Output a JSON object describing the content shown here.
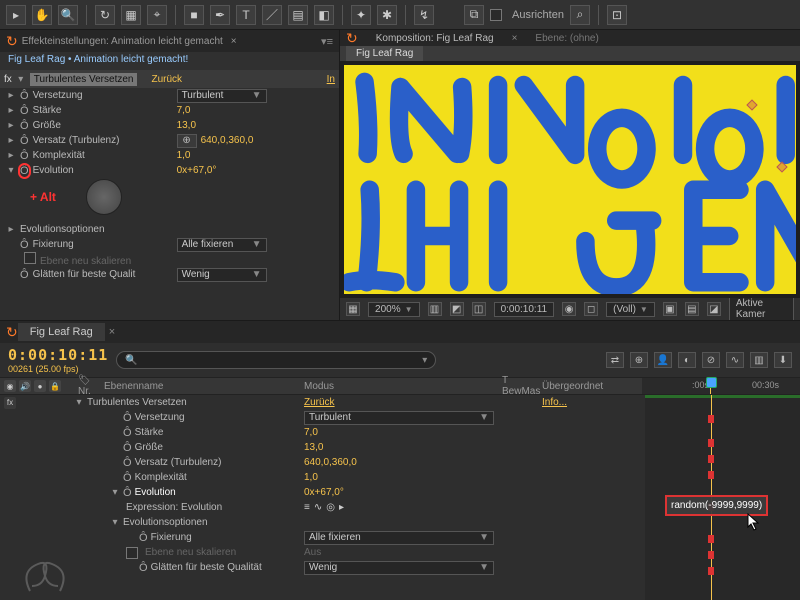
{
  "toolbar": {
    "align_label": "Ausrichten"
  },
  "effects_panel": {
    "tab": "Effekteinstellungen: Animation leicht gemacht",
    "breadcrumb": "Fig Leaf Rag • Animation leicht gemacht!",
    "effect_name": "Turbulentes Versetzen",
    "reset": "Zurück",
    "info": "In",
    "rows": [
      {
        "label": "Versetzung",
        "value": "Turbulent",
        "kind": "dropdown"
      },
      {
        "label": "Stärke",
        "value": "7,0",
        "kind": "num"
      },
      {
        "label": "Größe",
        "value": "13,0",
        "kind": "num"
      },
      {
        "label": "Versatz (Turbulenz)",
        "value": "640,0,360,0",
        "kind": "point"
      },
      {
        "label": "Komplexität",
        "value": "1,0",
        "kind": "num"
      },
      {
        "label": "Evolution",
        "value": "0x+67,0°",
        "kind": "angle"
      }
    ],
    "annotation": "+ Alt",
    "section2": "Evolutionsoptionen",
    "fix_label": "Fixierung",
    "fix_value": "Alle fixieren",
    "resize_label": "Ebene neu skalieren",
    "aa_label": "Glätten für beste Qualit",
    "aa_value": "Wenig"
  },
  "comp_panel": {
    "tab1": "Komposition: Fig Leaf Rag",
    "tab2": "Ebene: (ohne)",
    "active_tab": "Fig Leaf Rag",
    "footer": {
      "zoom": "200%",
      "timecode": "0:00:10:11",
      "res": "(Voll)",
      "camera": "Aktive Kamer"
    }
  },
  "timeline": {
    "tab": "Fig Leaf Rag",
    "timecode": "0:00:10:11",
    "fps": "00261 (25.00 fps)",
    "search_placeholder": "",
    "columns": {
      "nr": "Nr.",
      "name": "Ebenenname",
      "mode": "Modus",
      "trk": "T  BewMas",
      "parent": "Übergeordnet"
    },
    "ruler": {
      "t1": ":00s",
      "t2": "00:30s"
    },
    "layer": {
      "name": "Turbulentes Versetzen",
      "reset": "Zurück",
      "info": "Info..."
    },
    "props": [
      {
        "label": "Versetzung",
        "value": "Turbulent",
        "kind": "dropdown"
      },
      {
        "label": "Stärke",
        "value": "7,0",
        "kind": "num"
      },
      {
        "label": "Größe",
        "value": "13,0",
        "kind": "num"
      },
      {
        "label": "Versatz (Turbulenz)",
        "value": "640,0,360,0",
        "kind": "num"
      },
      {
        "label": "Komplexität",
        "value": "1,0",
        "kind": "num"
      },
      {
        "label": "Evolution",
        "value": "0x+67,0°",
        "kind": "num",
        "selected": true
      },
      {
        "label": "Expression: Evolution",
        "value": "expr",
        "kind": "expr"
      },
      {
        "label": "Evolutionsoptionen",
        "kind": "group"
      },
      {
        "label": "Fixierung",
        "value": "Alle fixieren",
        "kind": "dropdown"
      },
      {
        "label": "Ebene neu skalieren",
        "value": "Aus",
        "kind": "dim"
      },
      {
        "label": "Glätten für beste Qualität",
        "value": "Wenig",
        "kind": "dropdown"
      }
    ],
    "expression_text": "random(-9999,9999)"
  }
}
